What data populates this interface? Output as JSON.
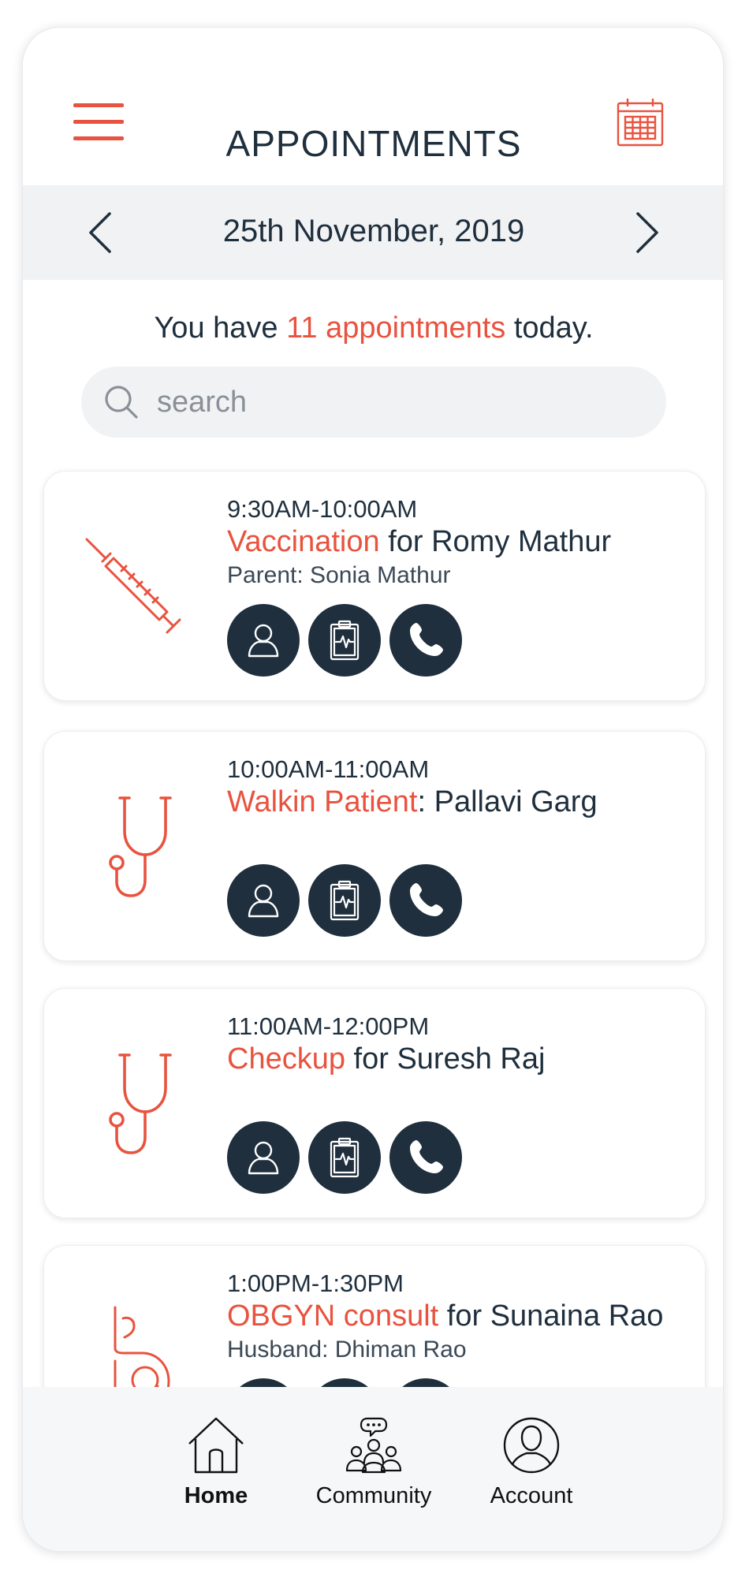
{
  "header": {
    "title": "APPOINTMENTS",
    "menu_icon": "hamburger-menu-icon",
    "calendar_icon": "calendar-icon"
  },
  "date_bar": {
    "date": "25th November, 2019",
    "prev_icon": "chevron-left-icon",
    "next_icon": "chevron-right-icon"
  },
  "summary": {
    "prefix": "You have ",
    "count_text": "11 appointments",
    "suffix": " today."
  },
  "search": {
    "placeholder": "search",
    "value": ""
  },
  "appointments": [
    {
      "time": "9:30AM-10:00AM",
      "type": "Vaccination",
      "joiner": " for ",
      "patient": "Romy Mathur",
      "sub": "Parent: Sonia Mathur",
      "icon": "syringe-icon"
    },
    {
      "time": "10:00AM-11:00AM",
      "type": "Walkin Patient",
      "joiner": ": ",
      "patient": "Pallavi Garg",
      "sub": "",
      "icon": "stethoscope-icon"
    },
    {
      "time": "11:00AM-12:00PM",
      "type": "Checkup",
      "joiner": " for ",
      "patient": "Suresh Raj",
      "sub": "",
      "icon": "stethoscope-icon"
    },
    {
      "time": "1:00PM-1:30PM",
      "type": "OBGYN consult",
      "joiner": " for ",
      "patient": "Sunaina Rao",
      "sub": "Husband: Dhiman Rao",
      "icon": "pregnancy-icon"
    }
  ],
  "actions": {
    "profile_icon": "user-profile-icon",
    "record_icon": "medical-record-icon",
    "call_icon": "phone-icon"
  },
  "nav": {
    "home": "Home",
    "community": "Community",
    "account": "Account"
  },
  "colors": {
    "accent": "#e8533f",
    "dark": "#1f2f3d",
    "date_bar_bg": "#f1f2f3",
    "nav_bg": "#f6f7f9"
  }
}
